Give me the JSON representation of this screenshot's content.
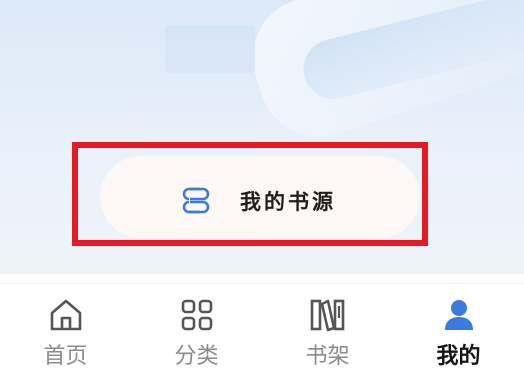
{
  "source_button": {
    "label": "我的书源",
    "icon": "book-source-icon"
  },
  "tabs": [
    {
      "label": "首页",
      "icon": "home-icon",
      "active": false
    },
    {
      "label": "分类",
      "icon": "grid-icon",
      "active": false
    },
    {
      "label": "书架",
      "icon": "bookshelf-icon",
      "active": false
    },
    {
      "label": "我的",
      "icon": "profile-icon",
      "active": true
    }
  ],
  "colors": {
    "accent": "#3b7be0",
    "highlight_border": "#e21c22",
    "inactive_tab": "#8a8a8a",
    "active_tab": "#151515"
  }
}
